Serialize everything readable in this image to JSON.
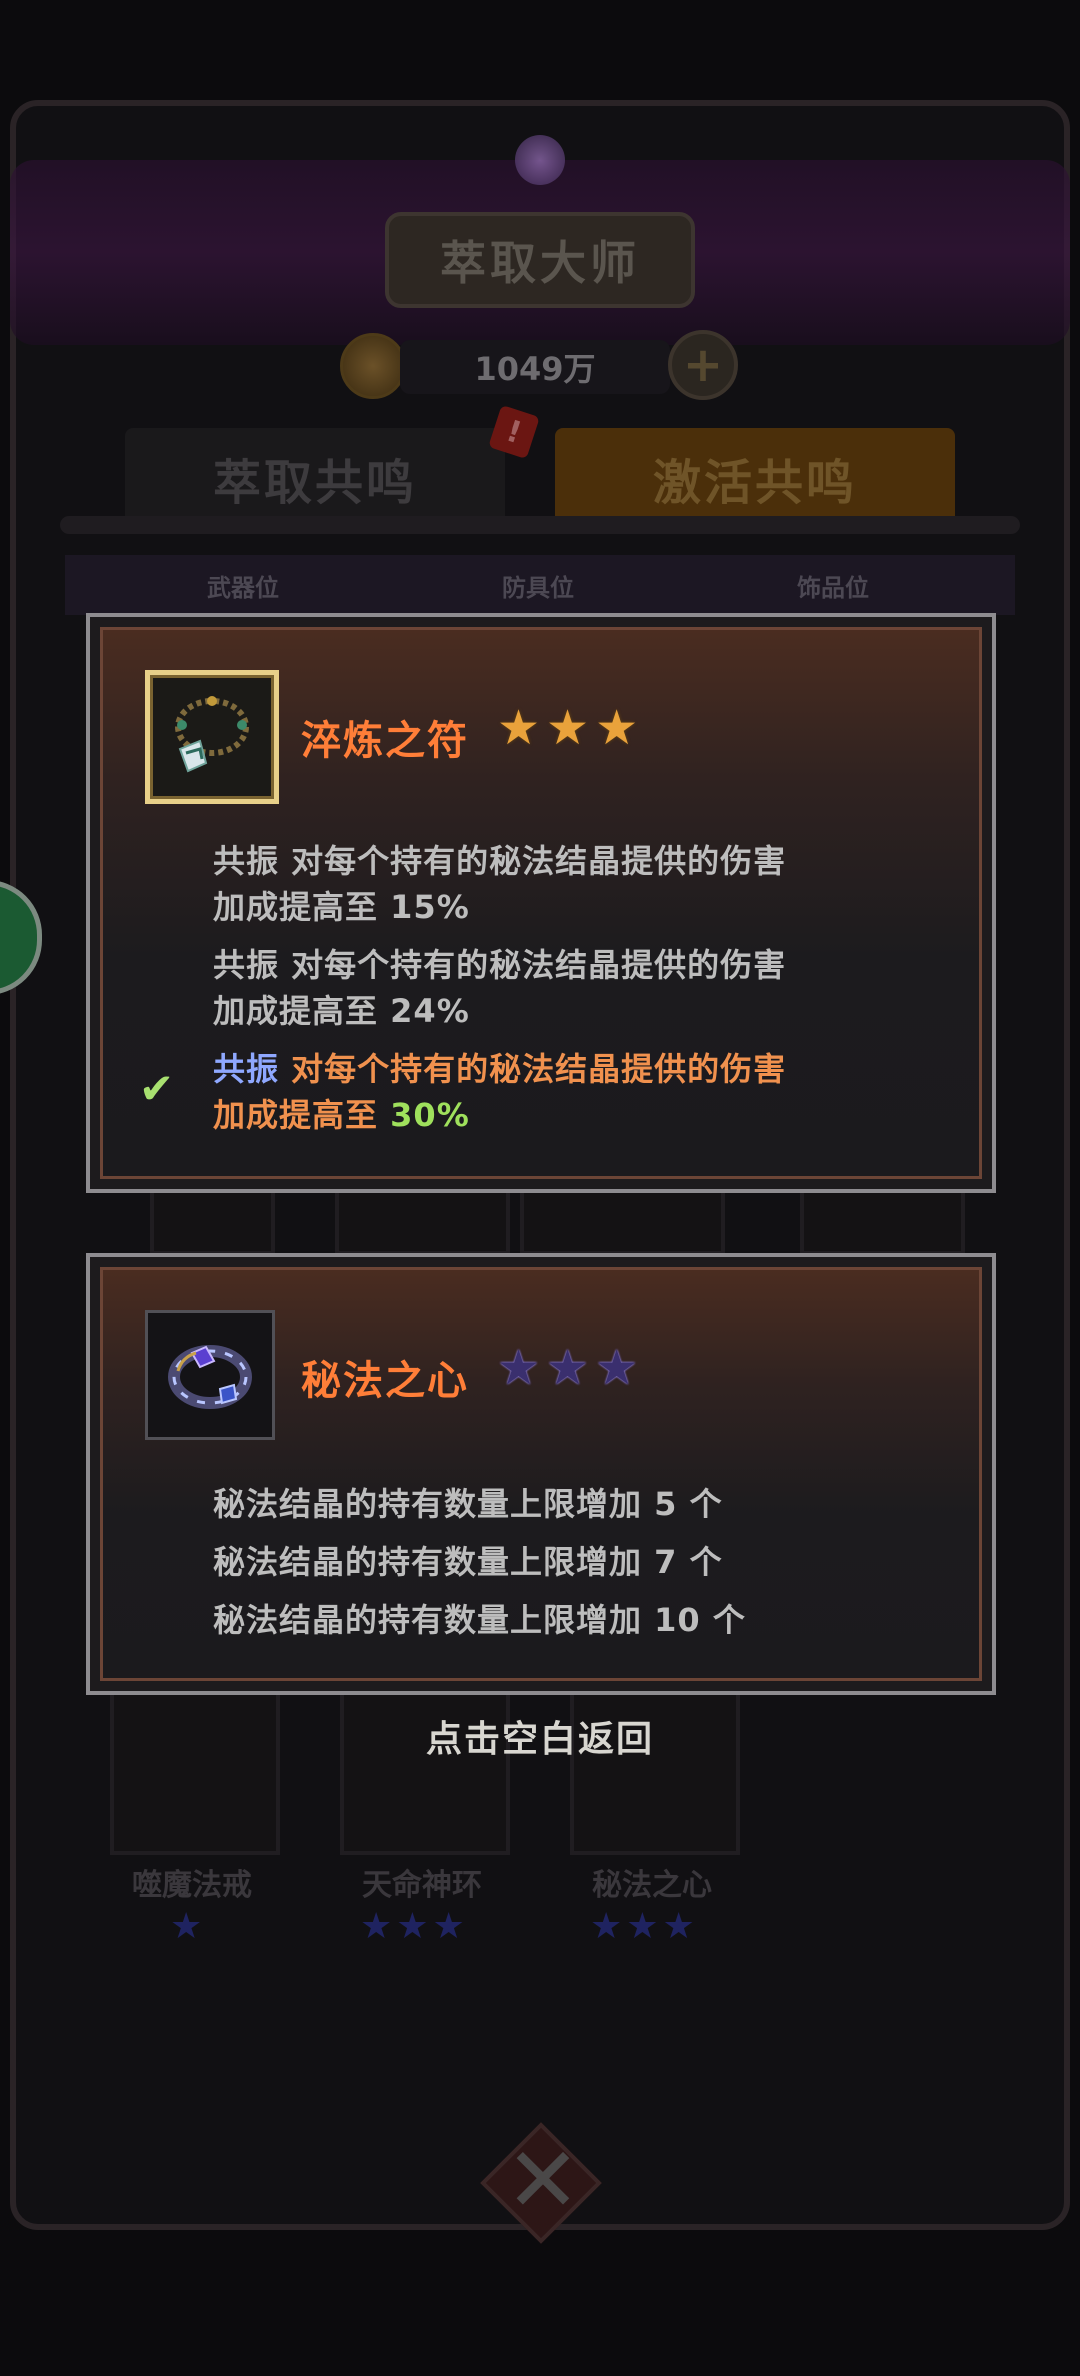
{
  "header": {
    "title": "萃取大师",
    "currency_amount": "1049万",
    "plus_label": "+"
  },
  "tabs": [
    {
      "label": "萃取共鸣"
    },
    {
      "label": "激活共鸣"
    }
  ],
  "tab_badge": "!",
  "slots": {
    "weapon": "武器位",
    "armor": "防具位",
    "accessory": "饰品位"
  },
  "background_items": [
    {
      "name": "噬魔法戒",
      "stars": "★"
    },
    {
      "name": "天命神环",
      "stars": "★★★"
    },
    {
      "name": "秘法之心",
      "stars": "★★★"
    }
  ],
  "popup1": {
    "title": "淬炼之符",
    "stars": [
      "★",
      "★",
      "★"
    ],
    "star_color": "#e9a23b",
    "tiers": [
      {
        "tag": "共振",
        "text": "对每个持有的秘法结晶提供的伤害",
        "line2": "加成提高至",
        "value": "15%",
        "active": false
      },
      {
        "tag": "共振",
        "text": "对每个持有的秘法结晶提供的伤害",
        "line2": "加成提高至",
        "value": "24%",
        "active": false
      },
      {
        "tag": "共振",
        "text": "对每个持有的秘法结晶提供的伤害",
        "line2": "加成提高至",
        "value": "30%",
        "active": true
      }
    ],
    "check_mark": "✔"
  },
  "popup2": {
    "title": "秘法之心",
    "stars": [
      "★",
      "★",
      "★"
    ],
    "star_color": "#3a2f6e",
    "lines": [
      {
        "text": "秘法结晶的持有数量上限增加",
        "value": "5",
        "unit": "个"
      },
      {
        "text": "秘法结晶的持有数量上限增加",
        "value": "7",
        "unit": "个"
      },
      {
        "text": "秘法结晶的持有数量上限增加",
        "value": "10",
        "unit": "个"
      }
    ]
  },
  "hint": "点击空白返回",
  "colors": {
    "title_orange": "#ff7e38",
    "active_tag_blue": "#8fa8ff",
    "active_text_orange": "#f0914e",
    "active_value_green": "#9fe05c",
    "inactive_text": "#bdbdbd"
  }
}
